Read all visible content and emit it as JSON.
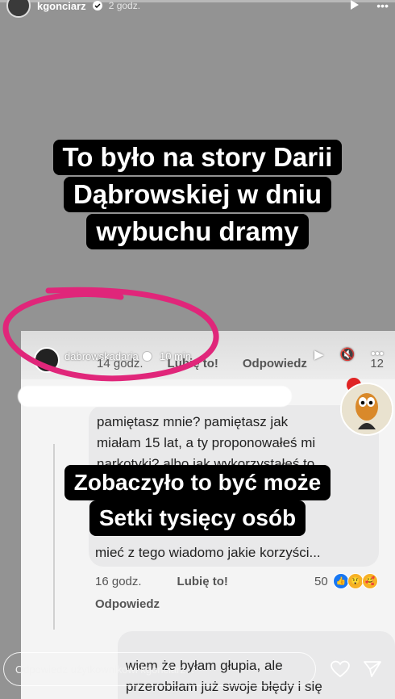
{
  "header": {
    "username": "kgonciarz",
    "time": "2 godz.",
    "icons": [
      "play-icon",
      "more-icon"
    ]
  },
  "caption_top": {
    "lines": [
      "To było na story Darii",
      "Dąbrowskiej w dniu",
      "wybuchu dramy"
    ]
  },
  "embedded_story": {
    "username": "dabrowskadaria",
    "time": "10 min",
    "fb_top_row": {
      "time": "14 godz.",
      "like": "Lubię to!",
      "reply": "Odpowiedz",
      "count": "12"
    },
    "comment_lines": [
      "pamiętasz mnie? pamiętasz jak",
      "miałam 15 lat, a ty  proponowałeś mi",
      "narkotyki? albo jak wykorzystałeś to"
    ],
    "comment_tail": "mieć z tego wiadomo jakie korzyści...",
    "meta": {
      "time": "16 godz.",
      "like": "Lubię to!",
      "reaction_count": "50",
      "reply": "Odpowiedz"
    },
    "comment2_lines": [
      "wiem że byłam głupia, ale",
      "przerobiłam już swoje błędy i się"
    ]
  },
  "caption_mid": {
    "lines": [
      "Zobaczyło to być może",
      "Setki tysięcy osób"
    ]
  },
  "reply_bar": {
    "placeholder": "Odpowiedz użytkownikowi kgonciarz..."
  },
  "colors": {
    "circle": "#e0267a",
    "caption_bg": "#000000",
    "fb_blue": "#1877f2"
  }
}
